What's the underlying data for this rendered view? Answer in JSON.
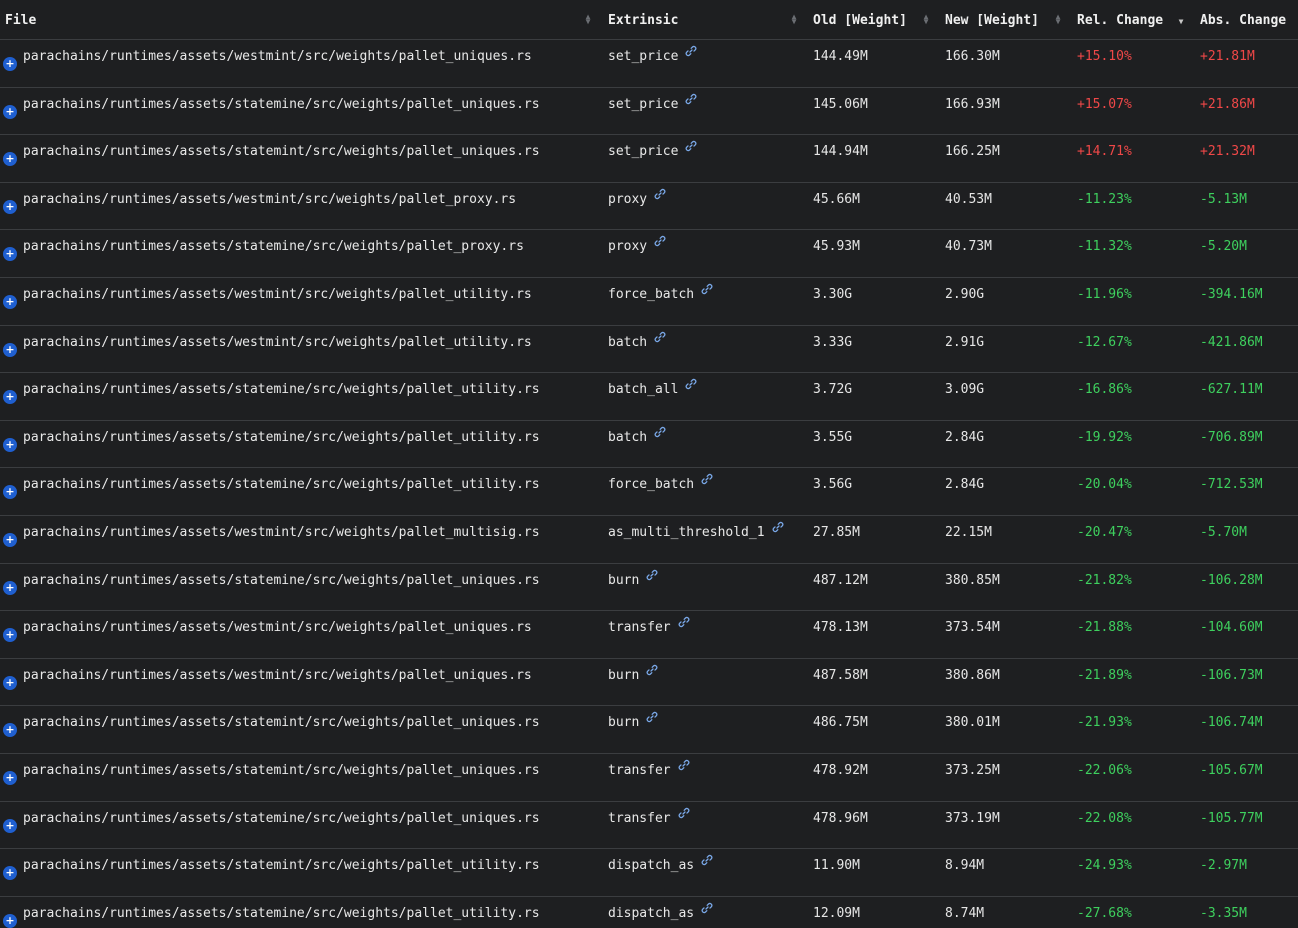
{
  "header": {
    "file": "File",
    "extrinsic": "Extrinsic",
    "old": "Old [Weight]",
    "new": "New [Weight]",
    "rel": "Rel. Change",
    "abs": "Abs. Change"
  },
  "icons": {
    "expand": "plus-circle-icon",
    "link": "link-icon",
    "sort": "sort-arrows-icon"
  },
  "colors": {
    "background": "#1e1f21",
    "increase": "#f04848",
    "decrease": "#3ed05e",
    "expand_button": "#1f5fd0"
  },
  "rows": [
    {
      "file": "parachains/runtimes/assets/westmint/src/weights/pallet_uniques.rs",
      "extrinsic": "set_price",
      "old": "144.49M",
      "new": "166.30M",
      "rel": "+15.10%",
      "abs": "+21.81M",
      "trend": "up"
    },
    {
      "file": "parachains/runtimes/assets/statemine/src/weights/pallet_uniques.rs",
      "extrinsic": "set_price",
      "old": "145.06M",
      "new": "166.93M",
      "rel": "+15.07%",
      "abs": "+21.86M",
      "trend": "up"
    },
    {
      "file": "parachains/runtimes/assets/statemint/src/weights/pallet_uniques.rs",
      "extrinsic": "set_price",
      "old": "144.94M",
      "new": "166.25M",
      "rel": "+14.71%",
      "abs": "+21.32M",
      "trend": "up"
    },
    {
      "file": "parachains/runtimes/assets/westmint/src/weights/pallet_proxy.rs",
      "extrinsic": "proxy",
      "old": "45.66M",
      "new": "40.53M",
      "rel": "-11.23%",
      "abs": "-5.13M",
      "trend": "down"
    },
    {
      "file": "parachains/runtimes/assets/statemine/src/weights/pallet_proxy.rs",
      "extrinsic": "proxy",
      "old": "45.93M",
      "new": "40.73M",
      "rel": "-11.32%",
      "abs": "-5.20M",
      "trend": "down"
    },
    {
      "file": "parachains/runtimes/assets/westmint/src/weights/pallet_utility.rs",
      "extrinsic": "force_batch",
      "old": "3.30G",
      "new": "2.90G",
      "rel": "-11.96%",
      "abs": "-394.16M",
      "trend": "down"
    },
    {
      "file": "parachains/runtimes/assets/westmint/src/weights/pallet_utility.rs",
      "extrinsic": "batch",
      "old": "3.33G",
      "new": "2.91G",
      "rel": "-12.67%",
      "abs": "-421.86M",
      "trend": "down"
    },
    {
      "file": "parachains/runtimes/assets/statemine/src/weights/pallet_utility.rs",
      "extrinsic": "batch_all",
      "old": "3.72G",
      "new": "3.09G",
      "rel": "-16.86%",
      "abs": "-627.11M",
      "trend": "down"
    },
    {
      "file": "parachains/runtimes/assets/statemine/src/weights/pallet_utility.rs",
      "extrinsic": "batch",
      "old": "3.55G",
      "new": "2.84G",
      "rel": "-19.92%",
      "abs": "-706.89M",
      "trend": "down"
    },
    {
      "file": "parachains/runtimes/assets/statemine/src/weights/pallet_utility.rs",
      "extrinsic": "force_batch",
      "old": "3.56G",
      "new": "2.84G",
      "rel": "-20.04%",
      "abs": "-712.53M",
      "trend": "down"
    },
    {
      "file": "parachains/runtimes/assets/westmint/src/weights/pallet_multisig.rs",
      "extrinsic": "as_multi_threshold_1",
      "old": "27.85M",
      "new": "22.15M",
      "rel": "-20.47%",
      "abs": "-5.70M",
      "trend": "down"
    },
    {
      "file": "parachains/runtimes/assets/statemine/src/weights/pallet_uniques.rs",
      "extrinsic": "burn",
      "old": "487.12M",
      "new": "380.85M",
      "rel": "-21.82%",
      "abs": "-106.28M",
      "trend": "down"
    },
    {
      "file": "parachains/runtimes/assets/westmint/src/weights/pallet_uniques.rs",
      "extrinsic": "transfer",
      "old": "478.13M",
      "new": "373.54M",
      "rel": "-21.88%",
      "abs": "-104.60M",
      "trend": "down"
    },
    {
      "file": "parachains/runtimes/assets/westmint/src/weights/pallet_uniques.rs",
      "extrinsic": "burn",
      "old": "487.58M",
      "new": "380.86M",
      "rel": "-21.89%",
      "abs": "-106.73M",
      "trend": "down"
    },
    {
      "file": "parachains/runtimes/assets/statemint/src/weights/pallet_uniques.rs",
      "extrinsic": "burn",
      "old": "486.75M",
      "new": "380.01M",
      "rel": "-21.93%",
      "abs": "-106.74M",
      "trend": "down"
    },
    {
      "file": "parachains/runtimes/assets/statemint/src/weights/pallet_uniques.rs",
      "extrinsic": "transfer",
      "old": "478.92M",
      "new": "373.25M",
      "rel": "-22.06%",
      "abs": "-105.67M",
      "trend": "down"
    },
    {
      "file": "parachains/runtimes/assets/statemine/src/weights/pallet_uniques.rs",
      "extrinsic": "transfer",
      "old": "478.96M",
      "new": "373.19M",
      "rel": "-22.08%",
      "abs": "-105.77M",
      "trend": "down"
    },
    {
      "file": "parachains/runtimes/assets/statemint/src/weights/pallet_utility.rs",
      "extrinsic": "dispatch_as",
      "old": "11.90M",
      "new": "8.94M",
      "rel": "-24.93%",
      "abs": "-2.97M",
      "trend": "down"
    },
    {
      "file": "parachains/runtimes/assets/statemine/src/weights/pallet_utility.rs",
      "extrinsic": "dispatch_as",
      "old": "12.09M",
      "new": "8.74M",
      "rel": "-27.68%",
      "abs": "-3.35M",
      "trend": "down"
    }
  ]
}
